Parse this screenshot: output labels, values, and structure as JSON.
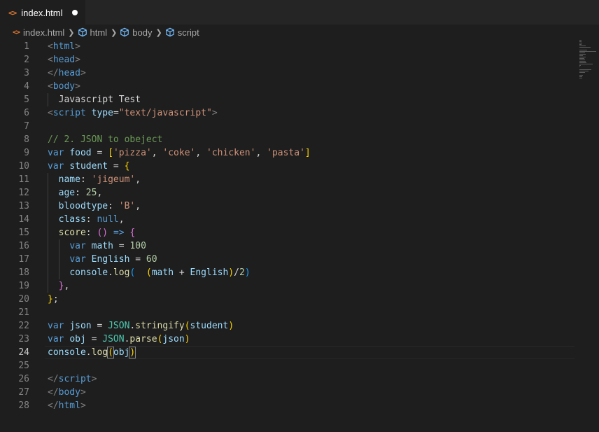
{
  "tab": {
    "icon": "html-file-icon",
    "filename": "index.html",
    "dirty": true
  },
  "breadcrumbs": [
    {
      "label": "index.html",
      "icon": "html-file-icon"
    },
    {
      "label": "html",
      "icon": "cube-icon"
    },
    {
      "label": "body",
      "icon": "cube-icon"
    },
    {
      "label": "script",
      "icon": "cube-icon"
    }
  ],
  "colors": {
    "tag": "#569cd6",
    "keyword": "#569cd6",
    "variable": "#9cdcfe",
    "string": "#ce9178",
    "number": "#b5cea8",
    "function": "#dcdcaa",
    "class": "#4ec9b0",
    "comment": "#6a9955",
    "background": "#1e1e1e"
  },
  "editor": {
    "active_line": 24,
    "lines": [
      {
        "n": 1,
        "tokens": [
          [
            "t-punct",
            "<"
          ],
          [
            "t-tag",
            "html"
          ],
          [
            "t-punct",
            ">"
          ]
        ]
      },
      {
        "n": 2,
        "tokens": [
          [
            "t-punct",
            "<"
          ],
          [
            "t-tag",
            "head"
          ],
          [
            "t-punct",
            ">"
          ]
        ]
      },
      {
        "n": 3,
        "tokens": [
          [
            "t-punct",
            "</"
          ],
          [
            "t-tag",
            "head"
          ],
          [
            "t-punct",
            ">"
          ]
        ]
      },
      {
        "n": 4,
        "tokens": [
          [
            "t-punct",
            "<"
          ],
          [
            "t-tag",
            "body"
          ],
          [
            "t-punct",
            ">"
          ]
        ]
      },
      {
        "n": 5,
        "tokens": [
          [
            "t-text",
            "  Javascript Test"
          ]
        ]
      },
      {
        "n": 6,
        "tokens": [
          [
            "t-punct",
            "<"
          ],
          [
            "t-tag",
            "script"
          ],
          [
            "t-text",
            " "
          ],
          [
            "t-attr",
            "type"
          ],
          [
            "t-text",
            "="
          ],
          [
            "t-str",
            "\"text/javascript\""
          ],
          [
            "t-punct",
            ">"
          ]
        ]
      },
      {
        "n": 7,
        "tokens": []
      },
      {
        "n": 8,
        "tokens": [
          [
            "t-com",
            "// 2. JSON to obeject"
          ]
        ]
      },
      {
        "n": 9,
        "tokens": [
          [
            "t-kw",
            "var"
          ],
          [
            "t-text",
            " "
          ],
          [
            "t-var",
            "food"
          ],
          [
            "t-text",
            " = "
          ],
          [
            "t-br1",
            "["
          ],
          [
            "t-str",
            "'pizza'"
          ],
          [
            "t-text",
            ", "
          ],
          [
            "t-str",
            "'coke'"
          ],
          [
            "t-text",
            ", "
          ],
          [
            "t-str",
            "'chicken'"
          ],
          [
            "t-text",
            ", "
          ],
          [
            "t-str",
            "'pasta'"
          ],
          [
            "t-br1",
            "]"
          ]
        ]
      },
      {
        "n": 10,
        "tokens": [
          [
            "t-kw",
            "var"
          ],
          [
            "t-text",
            " "
          ],
          [
            "t-var",
            "student"
          ],
          [
            "t-text",
            " = "
          ],
          [
            "t-br1",
            "{"
          ]
        ]
      },
      {
        "n": 11,
        "tokens": [
          [
            "t-text",
            "  "
          ],
          [
            "t-var",
            "name"
          ],
          [
            "t-text",
            ": "
          ],
          [
            "t-str",
            "'jigeum'"
          ],
          [
            "t-text",
            ","
          ]
        ]
      },
      {
        "n": 12,
        "tokens": [
          [
            "t-text",
            "  "
          ],
          [
            "t-var",
            "age"
          ],
          [
            "t-text",
            ": "
          ],
          [
            "t-num",
            "25"
          ],
          [
            "t-text",
            ","
          ]
        ]
      },
      {
        "n": 13,
        "tokens": [
          [
            "t-text",
            "  "
          ],
          [
            "t-var",
            "bloodtype"
          ],
          [
            "t-text",
            ": "
          ],
          [
            "t-str",
            "'B'"
          ],
          [
            "t-text",
            ","
          ]
        ]
      },
      {
        "n": 14,
        "tokens": [
          [
            "t-text",
            "  "
          ],
          [
            "t-var",
            "class"
          ],
          [
            "t-text",
            ": "
          ],
          [
            "t-kw",
            "null"
          ],
          [
            "t-text",
            ","
          ]
        ]
      },
      {
        "n": 15,
        "tokens": [
          [
            "t-text",
            "  "
          ],
          [
            "t-fn",
            "score"
          ],
          [
            "t-text",
            ": "
          ],
          [
            "t-br2",
            "()"
          ],
          [
            "t-text",
            " "
          ],
          [
            "t-kw",
            "=>"
          ],
          [
            "t-text",
            " "
          ],
          [
            "t-br2",
            "{"
          ]
        ]
      },
      {
        "n": 16,
        "tokens": [
          [
            "t-text",
            "    "
          ],
          [
            "t-kw",
            "var"
          ],
          [
            "t-text",
            " "
          ],
          [
            "t-var",
            "math"
          ],
          [
            "t-text",
            " = "
          ],
          [
            "t-num",
            "100"
          ]
        ]
      },
      {
        "n": 17,
        "tokens": [
          [
            "t-text",
            "    "
          ],
          [
            "t-kw",
            "var"
          ],
          [
            "t-text",
            " "
          ],
          [
            "t-var",
            "English"
          ],
          [
            "t-text",
            " = "
          ],
          [
            "t-num",
            "60"
          ]
        ]
      },
      {
        "n": 18,
        "tokens": [
          [
            "t-text",
            "    "
          ],
          [
            "t-var",
            "console"
          ],
          [
            "t-text",
            "."
          ],
          [
            "t-fn",
            "log"
          ],
          [
            "t-br3",
            "("
          ],
          [
            "t-text",
            "  "
          ],
          [
            "t-br1",
            "("
          ],
          [
            "t-var",
            "math"
          ],
          [
            "t-text",
            " + "
          ],
          [
            "t-var",
            "English"
          ],
          [
            "t-br1",
            ")"
          ],
          [
            "t-text",
            "/"
          ],
          [
            "t-num",
            "2"
          ],
          [
            "t-br3",
            ")"
          ]
        ]
      },
      {
        "n": 19,
        "tokens": [
          [
            "t-text",
            "  "
          ],
          [
            "t-br2",
            "}"
          ],
          [
            "t-text",
            ","
          ]
        ]
      },
      {
        "n": 20,
        "tokens": [
          [
            "t-br1",
            "}"
          ],
          [
            "t-text",
            ";"
          ]
        ]
      },
      {
        "n": 21,
        "tokens": []
      },
      {
        "n": 22,
        "tokens": [
          [
            "t-kw",
            "var"
          ],
          [
            "t-text",
            " "
          ],
          [
            "t-var",
            "json"
          ],
          [
            "t-text",
            " = "
          ],
          [
            "t-cls",
            "JSON"
          ],
          [
            "t-text",
            "."
          ],
          [
            "t-fn",
            "stringify"
          ],
          [
            "t-br1",
            "("
          ],
          [
            "t-var",
            "student"
          ],
          [
            "t-br1",
            ")"
          ]
        ]
      },
      {
        "n": 23,
        "tokens": [
          [
            "t-kw",
            "var"
          ],
          [
            "t-text",
            " "
          ],
          [
            "t-var",
            "obj"
          ],
          [
            "t-text",
            " = "
          ],
          [
            "t-cls",
            "JSON"
          ],
          [
            "t-text",
            "."
          ],
          [
            "t-fn",
            "parse"
          ],
          [
            "t-br1",
            "("
          ],
          [
            "t-var",
            "json"
          ],
          [
            "t-br1",
            ")"
          ]
        ]
      },
      {
        "n": 24,
        "tokens": [
          [
            "t-var",
            "console"
          ],
          [
            "t-text",
            "."
          ],
          [
            "t-fn",
            "log"
          ],
          [
            "t-br1",
            "("
          ],
          [
            "t-var",
            "obj"
          ],
          [
            "t-br1",
            ")"
          ]
        ]
      },
      {
        "n": 25,
        "tokens": []
      },
      {
        "n": 26,
        "tokens": [
          [
            "t-punct",
            "</"
          ],
          [
            "t-tag",
            "script"
          ],
          [
            "t-punct",
            ">"
          ]
        ]
      },
      {
        "n": 27,
        "tokens": [
          [
            "t-punct",
            "</"
          ],
          [
            "t-tag",
            "body"
          ],
          [
            "t-punct",
            ">"
          ]
        ]
      },
      {
        "n": 28,
        "tokens": [
          [
            "t-punct",
            "</"
          ],
          [
            "t-tag",
            "html"
          ],
          [
            "t-punct",
            ">"
          ]
        ]
      }
    ]
  }
}
